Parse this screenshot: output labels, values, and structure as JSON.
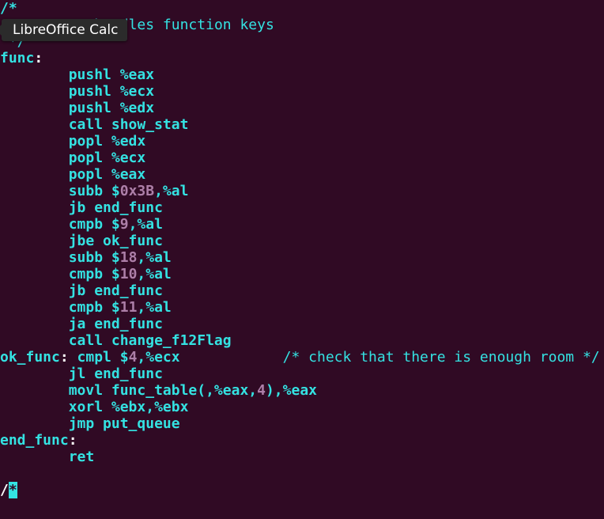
{
  "tooltip": {
    "label": "LibreOffice Calc"
  },
  "code": {
    "l0": "/*",
    "l1_prefix": "         ",
    "l1": "e handles function keys",
    "l2": " */",
    "l3_label": "func",
    "l4": "pushl %eax",
    "l5": "pushl %ecx",
    "l6": "pushl %edx",
    "l7": "call show_stat",
    "l8": "popl %edx",
    "l9": "popl %ecx",
    "l10": "popl %eax",
    "l11_op": "subb $",
    "l11_num": "0x3B",
    "l11_rest": ",%al",
    "l12": "jb end_func",
    "l13_op": "cmpb $",
    "l13_num": "9",
    "l13_rest": ",%al",
    "l14": "jbe ok_func",
    "l15_op": "subb $",
    "l15_num": "18",
    "l15_rest": ",%al",
    "l16_op": "cmpb $",
    "l16_num": "10",
    "l16_rest": ",%al",
    "l17": "jb end_func",
    "l18_op": "cmpb $",
    "l18_num": "11",
    "l18_rest": ",%al",
    "l19": "ja end_func",
    "l20": "call change_f12Flag",
    "l21_label": "ok_func",
    "l21_op": "cmpl $",
    "l21_num": "4",
    "l21_rest": ",%ecx",
    "l21_comment": "/* check that there is enough room */",
    "l22": "jl end_func",
    "l23_a": "movl func_table(,%eax,",
    "l23_num": "4",
    "l23_b": "),%eax",
    "l24": "xorl %ebx,%ebx",
    "l25": "jmp put_queue",
    "l26_label": "end_func",
    "l27": "ret",
    "l29_slash": "/",
    "l29_cursor": "*"
  }
}
